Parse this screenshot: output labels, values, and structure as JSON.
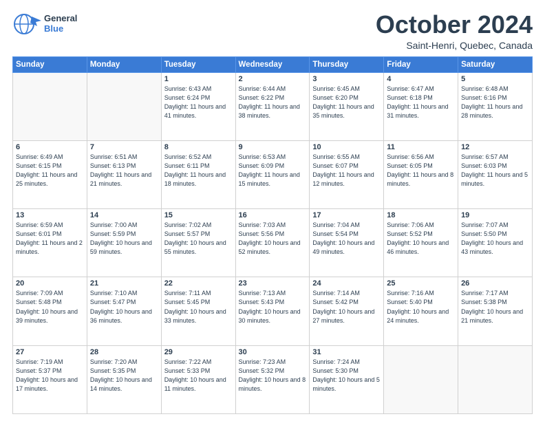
{
  "logo": {
    "line1": "General",
    "line2": "Blue"
  },
  "title": "October 2024",
  "location": "Saint-Henri, Quebec, Canada",
  "weekdays": [
    "Sunday",
    "Monday",
    "Tuesday",
    "Wednesday",
    "Thursday",
    "Friday",
    "Saturday"
  ],
  "weeks": [
    [
      {
        "day": "",
        "info": ""
      },
      {
        "day": "",
        "info": ""
      },
      {
        "day": "1",
        "info": "Sunrise: 6:43 AM\nSunset: 6:24 PM\nDaylight: 11 hours and 41 minutes."
      },
      {
        "day": "2",
        "info": "Sunrise: 6:44 AM\nSunset: 6:22 PM\nDaylight: 11 hours and 38 minutes."
      },
      {
        "day": "3",
        "info": "Sunrise: 6:45 AM\nSunset: 6:20 PM\nDaylight: 11 hours and 35 minutes."
      },
      {
        "day": "4",
        "info": "Sunrise: 6:47 AM\nSunset: 6:18 PM\nDaylight: 11 hours and 31 minutes."
      },
      {
        "day": "5",
        "info": "Sunrise: 6:48 AM\nSunset: 6:16 PM\nDaylight: 11 hours and 28 minutes."
      }
    ],
    [
      {
        "day": "6",
        "info": "Sunrise: 6:49 AM\nSunset: 6:15 PM\nDaylight: 11 hours and 25 minutes."
      },
      {
        "day": "7",
        "info": "Sunrise: 6:51 AM\nSunset: 6:13 PM\nDaylight: 11 hours and 21 minutes."
      },
      {
        "day": "8",
        "info": "Sunrise: 6:52 AM\nSunset: 6:11 PM\nDaylight: 11 hours and 18 minutes."
      },
      {
        "day": "9",
        "info": "Sunrise: 6:53 AM\nSunset: 6:09 PM\nDaylight: 11 hours and 15 minutes."
      },
      {
        "day": "10",
        "info": "Sunrise: 6:55 AM\nSunset: 6:07 PM\nDaylight: 11 hours and 12 minutes."
      },
      {
        "day": "11",
        "info": "Sunrise: 6:56 AM\nSunset: 6:05 PM\nDaylight: 11 hours and 8 minutes."
      },
      {
        "day": "12",
        "info": "Sunrise: 6:57 AM\nSunset: 6:03 PM\nDaylight: 11 hours and 5 minutes."
      }
    ],
    [
      {
        "day": "13",
        "info": "Sunrise: 6:59 AM\nSunset: 6:01 PM\nDaylight: 11 hours and 2 minutes."
      },
      {
        "day": "14",
        "info": "Sunrise: 7:00 AM\nSunset: 5:59 PM\nDaylight: 10 hours and 59 minutes."
      },
      {
        "day": "15",
        "info": "Sunrise: 7:02 AM\nSunset: 5:57 PM\nDaylight: 10 hours and 55 minutes."
      },
      {
        "day": "16",
        "info": "Sunrise: 7:03 AM\nSunset: 5:56 PM\nDaylight: 10 hours and 52 minutes."
      },
      {
        "day": "17",
        "info": "Sunrise: 7:04 AM\nSunset: 5:54 PM\nDaylight: 10 hours and 49 minutes."
      },
      {
        "day": "18",
        "info": "Sunrise: 7:06 AM\nSunset: 5:52 PM\nDaylight: 10 hours and 46 minutes."
      },
      {
        "day": "19",
        "info": "Sunrise: 7:07 AM\nSunset: 5:50 PM\nDaylight: 10 hours and 43 minutes."
      }
    ],
    [
      {
        "day": "20",
        "info": "Sunrise: 7:09 AM\nSunset: 5:48 PM\nDaylight: 10 hours and 39 minutes."
      },
      {
        "day": "21",
        "info": "Sunrise: 7:10 AM\nSunset: 5:47 PM\nDaylight: 10 hours and 36 minutes."
      },
      {
        "day": "22",
        "info": "Sunrise: 7:11 AM\nSunset: 5:45 PM\nDaylight: 10 hours and 33 minutes."
      },
      {
        "day": "23",
        "info": "Sunrise: 7:13 AM\nSunset: 5:43 PM\nDaylight: 10 hours and 30 minutes."
      },
      {
        "day": "24",
        "info": "Sunrise: 7:14 AM\nSunset: 5:42 PM\nDaylight: 10 hours and 27 minutes."
      },
      {
        "day": "25",
        "info": "Sunrise: 7:16 AM\nSunset: 5:40 PM\nDaylight: 10 hours and 24 minutes."
      },
      {
        "day": "26",
        "info": "Sunrise: 7:17 AM\nSunset: 5:38 PM\nDaylight: 10 hours and 21 minutes."
      }
    ],
    [
      {
        "day": "27",
        "info": "Sunrise: 7:19 AM\nSunset: 5:37 PM\nDaylight: 10 hours and 17 minutes."
      },
      {
        "day": "28",
        "info": "Sunrise: 7:20 AM\nSunset: 5:35 PM\nDaylight: 10 hours and 14 minutes."
      },
      {
        "day": "29",
        "info": "Sunrise: 7:22 AM\nSunset: 5:33 PM\nDaylight: 10 hours and 11 minutes."
      },
      {
        "day": "30",
        "info": "Sunrise: 7:23 AM\nSunset: 5:32 PM\nDaylight: 10 hours and 8 minutes."
      },
      {
        "day": "31",
        "info": "Sunrise: 7:24 AM\nSunset: 5:30 PM\nDaylight: 10 hours and 5 minutes."
      },
      {
        "day": "",
        "info": ""
      },
      {
        "day": "",
        "info": ""
      }
    ]
  ]
}
